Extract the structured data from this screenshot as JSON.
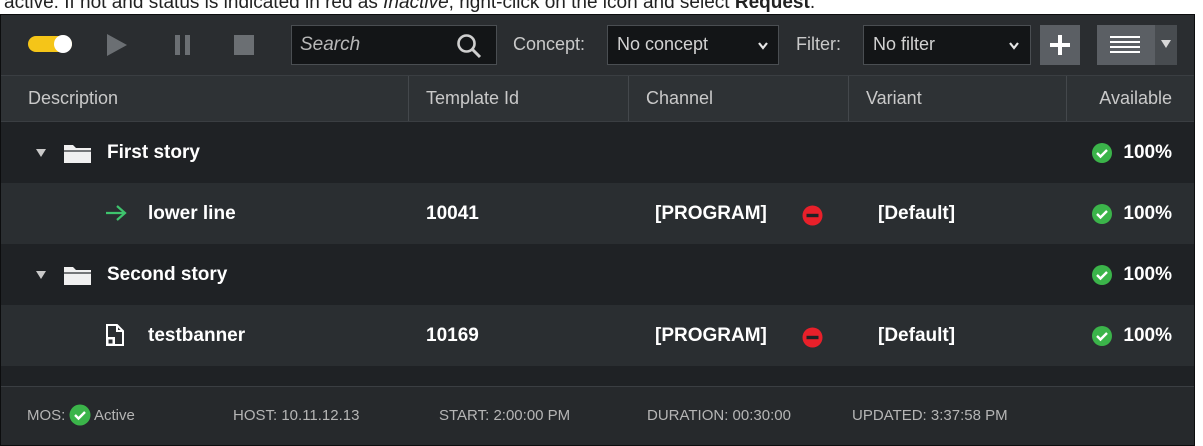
{
  "toolbar": {
    "search_placeholder": "Search",
    "concept_label": "Concept:",
    "concept_value": "No concept",
    "filter_label": "Filter:",
    "filter_value": "No filter",
    "toggle_accent": "#f5c518"
  },
  "columns": [
    "Description",
    "Template Id",
    "Channel",
    "Variant",
    "Available"
  ],
  "rows": [
    {
      "type": "story",
      "description": "First story",
      "available": "100%"
    },
    {
      "type": "item",
      "icon": "arrow-right-icon",
      "description": "lower line",
      "template_id": "10041",
      "channel": "[PROGRAM]",
      "variant": "[Default]",
      "available": "100%"
    },
    {
      "type": "story",
      "description": "Second story",
      "available": "100%"
    },
    {
      "type": "item",
      "icon": "template-file-icon",
      "description": "testbanner",
      "template_id": "10169",
      "channel": "[PROGRAM]",
      "variant": "[Default]",
      "available": "100%"
    }
  ],
  "status": {
    "mos_label": "MOS:",
    "mos_state": "Active",
    "host": "HOST: 10.11.12.13",
    "start": "START: 2:00:00 PM",
    "duration": "DURATION: 00:30:00",
    "updated": "UPDATED: 3:37:58 PM"
  },
  "colors": {
    "ok_green": "#3bb44a",
    "arrow_green": "#3ec46d",
    "blocked_red": "#e8202a",
    "panel_bg": "#1f2225"
  }
}
